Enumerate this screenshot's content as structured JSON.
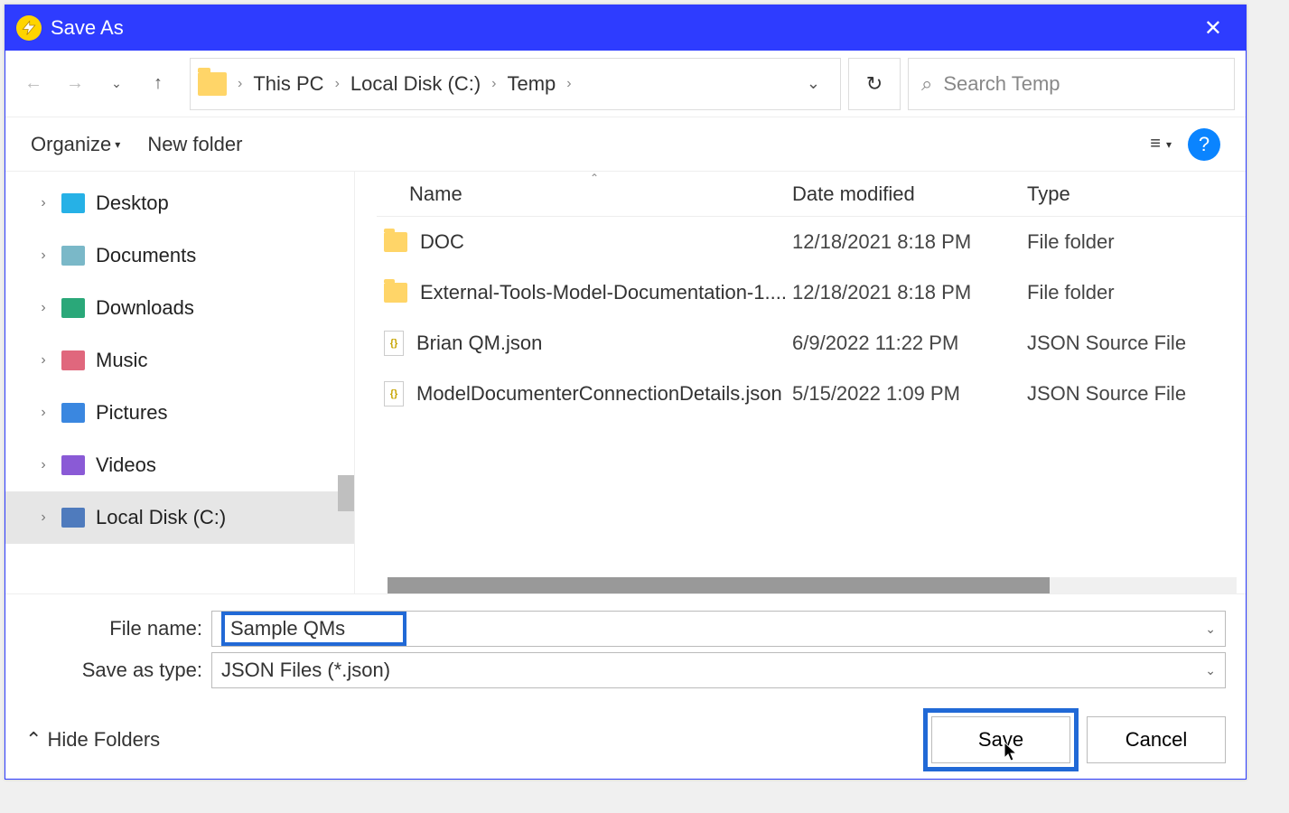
{
  "title": "Save As",
  "breadcrumb": {
    "parts": [
      "This PC",
      "Local Disk (C:)",
      "Temp"
    ]
  },
  "search_placeholder": "Search Temp",
  "toolbar": {
    "organize": "Organize",
    "newfolder": "New folder"
  },
  "tree": [
    {
      "label": "Desktop",
      "color": "#26b1e6"
    },
    {
      "label": "Documents",
      "color": "#7ab8c8"
    },
    {
      "label": "Downloads",
      "color": "#2aa879"
    },
    {
      "label": "Music",
      "color": "#e0677d"
    },
    {
      "label": "Pictures",
      "color": "#3a87e0"
    },
    {
      "label": "Videos",
      "color": "#8a5ad6"
    },
    {
      "label": "Local Disk (C:)",
      "color": "#4f7bbd",
      "selected": true
    }
  ],
  "columns": {
    "name": "Name",
    "date": "Date modified",
    "type": "Type"
  },
  "files": [
    {
      "icon": "folder",
      "name": "DOC",
      "date": "12/18/2021 8:18 PM",
      "type": "File folder"
    },
    {
      "icon": "folder",
      "name": "External-Tools-Model-Documentation-1....",
      "date": "12/18/2021 8:18 PM",
      "type": "File folder"
    },
    {
      "icon": "json",
      "name": "Brian QM.json",
      "date": "6/9/2022 11:22 PM",
      "type": "JSON Source File"
    },
    {
      "icon": "json",
      "name": "ModelDocumenterConnectionDetails.json",
      "date": "5/15/2022 1:09 PM",
      "type": "JSON Source File"
    }
  ],
  "form": {
    "filename_label": "File name:",
    "filename_value": "Sample QMs",
    "type_label": "Save as type:",
    "type_value": "JSON Files (*.json)"
  },
  "footer": {
    "hide": "Hide Folders",
    "save": "Save",
    "cancel": "Cancel"
  }
}
